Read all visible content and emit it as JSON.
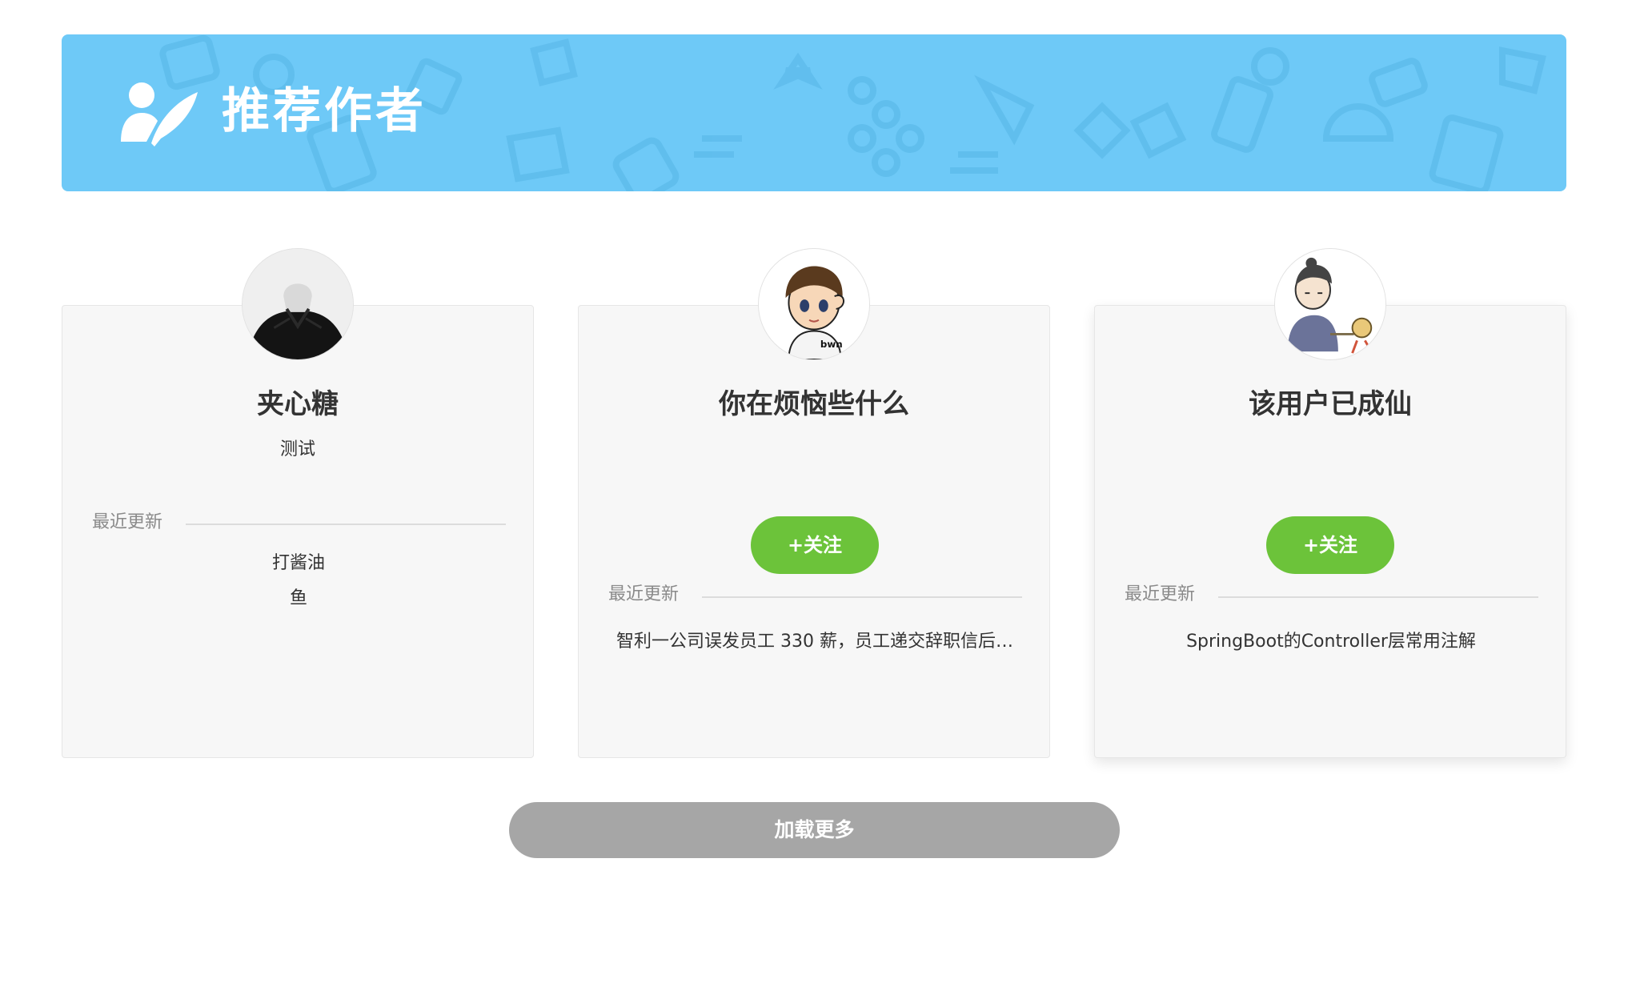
{
  "banner": {
    "title": "推荐作者",
    "icon": "author-feather-icon",
    "color": "#6ec9f7"
  },
  "authors": [
    {
      "name": "夹心糖",
      "bio": "测试",
      "avatar": "black-sweater-avatar",
      "follow_label": "",
      "recent_label": "最近更新",
      "articles": [
        "打酱油",
        "鱼"
      ]
    },
    {
      "name": "你在烦恼些什么",
      "bio": "",
      "avatar": "cartoon-boy-avatar",
      "follow_label": "+关注",
      "recent_label": "最近更新",
      "articles": [
        "智利一公司误发员工 330 薪，员工递交辞职信后…"
      ]
    },
    {
      "name": "该用户已成仙",
      "bio": "",
      "avatar": "cartoon-monk-avatar",
      "follow_label": "+关注",
      "recent_label": "最近更新",
      "articles": [
        "SpringBoot的Controller层常用注解"
      ]
    }
  ],
  "load_more_label": "加载更多",
  "colors": {
    "follow_button": "#6cc33a",
    "load_more": "#a6a6a6",
    "card_bg": "#f7f7f7"
  }
}
